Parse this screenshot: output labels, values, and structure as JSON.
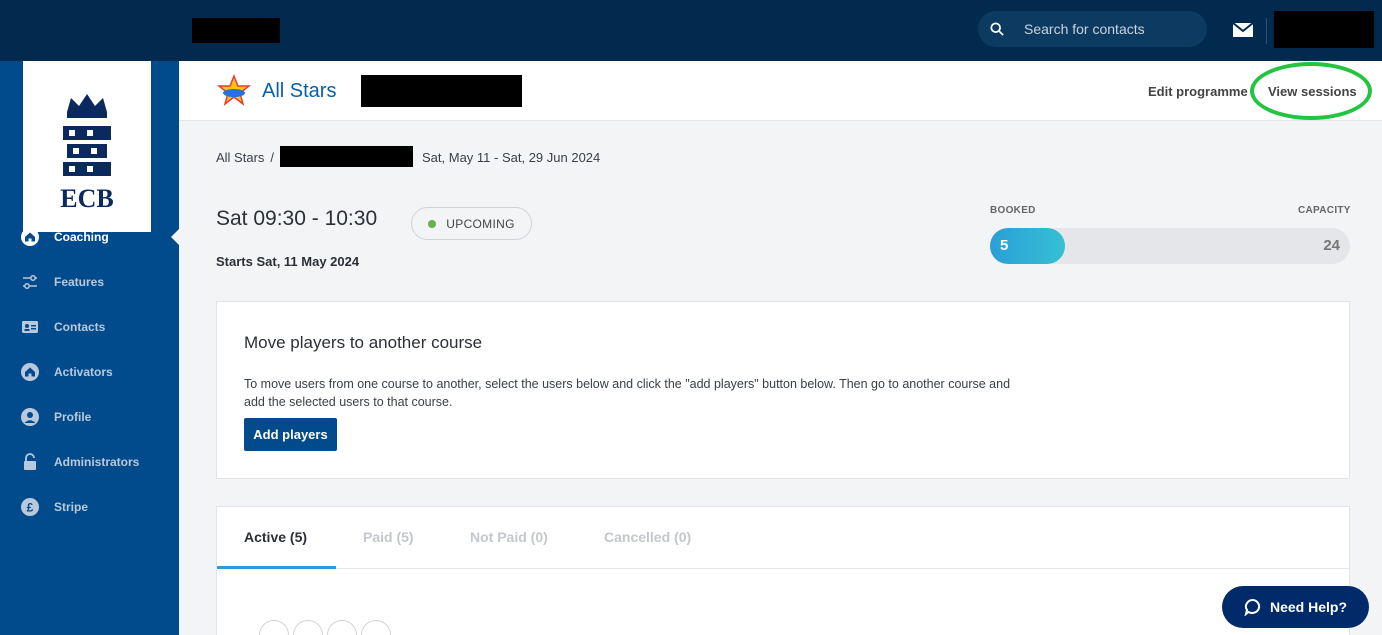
{
  "topbar": {
    "search_placeholder": "Search for contacts",
    "icons": [
      "search-icon",
      "mail-icon"
    ]
  },
  "sidebar": {
    "logo_text": "ECB",
    "items": [
      {
        "label": "Coaching",
        "icon": "home-icon",
        "active": true
      },
      {
        "label": "Features",
        "icon": "sliders-icon",
        "active": false
      },
      {
        "label": "Contacts",
        "icon": "id-card-icon",
        "active": false
      },
      {
        "label": "Activators",
        "icon": "home-icon",
        "active": false
      },
      {
        "label": "Profile",
        "icon": "user-icon",
        "active": false
      },
      {
        "label": "Administrators",
        "icon": "lock-icon",
        "active": false
      },
      {
        "label": "Stripe",
        "icon": "pound-icon",
        "active": false
      }
    ]
  },
  "header": {
    "programme_title": "All Stars",
    "edit_label": "Edit programme",
    "view_sessions_label": "View sessions"
  },
  "breadcrumb": {
    "root": "All Stars",
    "separator": "/",
    "date_range": "Sat, May 11 - Sat, 29 Jun 2024"
  },
  "session": {
    "time": "Sat 09:30 - 10:30",
    "status": "UPCOMING",
    "starts": "Starts Sat, 11 May 2024",
    "booked_label": "BOOKED",
    "capacity_label": "CAPACITY",
    "booked": 5,
    "capacity": 24
  },
  "move_card": {
    "title": "Move players to another course",
    "description": "To move users from one course to another, select the users below and click the \"add players\" button below. Then go to another course and add the selected users to that course.",
    "button_label": "Add players"
  },
  "tabs": [
    {
      "label": "Active (5)",
      "active": true
    },
    {
      "label": "Paid (5)",
      "active": false
    },
    {
      "label": "Not Paid (0)",
      "active": false
    },
    {
      "label": "Cancelled (0)",
      "active": false
    }
  ],
  "help_label": "Need Help?",
  "colors": {
    "topbar": "#012a4e",
    "sidebar": "#014b8d",
    "accent": "#0b5fa8",
    "highlight": "#22c440",
    "bar": "#2a9fd6"
  }
}
